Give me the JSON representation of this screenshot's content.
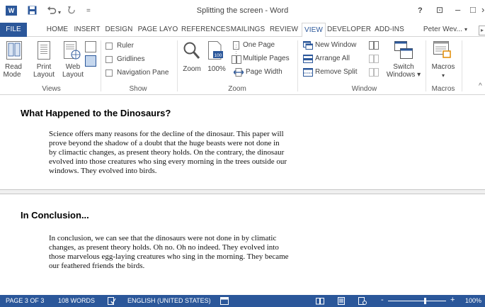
{
  "titlebar": {
    "app_icon": "W",
    "save_icon": "save-icon",
    "undo_icon": "undo-icon",
    "redo_icon": "redo-icon",
    "title": "Splitting the screen - Word",
    "help": "?",
    "minimize": "–",
    "restore": "□",
    "close": "✕"
  },
  "tabs": [
    "FILE",
    "HOME",
    "INSERT",
    "DESIGN",
    "PAGE LAYO",
    "REFERENCES",
    "MAILINGS",
    "REVIEW",
    "VIEW",
    "DEVELOPER",
    "ADD-INS"
  ],
  "account": "Peter Wev...",
  "account_arrow": "▸",
  "ribbon": {
    "views": {
      "label": "Views",
      "read_mode": [
        "Read",
        "Mode"
      ],
      "print_layout": [
        "Print",
        "Layout"
      ],
      "web_layout": [
        "Web",
        "Layout"
      ]
    },
    "show": {
      "label": "Show",
      "ruler": "Ruler",
      "gridlines": "Gridlines",
      "navigation_pane": "Navigation Pane"
    },
    "zoom": {
      "label": "Zoom",
      "zoom": "Zoom",
      "zoom_100": "100%",
      "one_page": "One Page",
      "multiple_pages": "Multiple Pages",
      "page_width": "Page Width"
    },
    "window": {
      "label": "Window",
      "new_window": "New Window",
      "arrange_all": "Arrange All",
      "remove_split": "Remove Split",
      "switch_windows": [
        "Switch",
        "Windows ▾"
      ]
    },
    "macros": {
      "label": "Macros",
      "macros": "Macros",
      "arrow": "▾"
    },
    "collapse": "^"
  },
  "document": {
    "top": {
      "heading": "What Happened to the Dinosaurs?",
      "lines": [
        "Science offers many reasons for the decline of the dinosaur. This paper will",
        "prove beyond the shadow of a doubt that the huge beasts were not done in",
        "by climactic changes, as present theory holds. On the contrary, the dinosaur",
        "evolved into those creatures who sing every morning in the trees outside our",
        "windows. They evolved into birds."
      ]
    },
    "bottom": {
      "heading": "In Conclusion...",
      "lines": [
        "In conclusion, we can see that the dinosaurs were not done in by climatic",
        "changes, as present theory holds. Oh no. Oh no indeed. They evolved into",
        "those marvelous egg-laying creatures who sing in the morning. They became",
        "our feathered friends the birds."
      ]
    }
  },
  "statusbar": {
    "page": "PAGE 3 OF 3",
    "words": "108 WORDS",
    "language": "ENGLISH (UNITED STATES)",
    "zoom_minus": "-",
    "zoom_plus": "+",
    "zoom": "100%"
  },
  "colors": {
    "accent": "#2b579a"
  }
}
